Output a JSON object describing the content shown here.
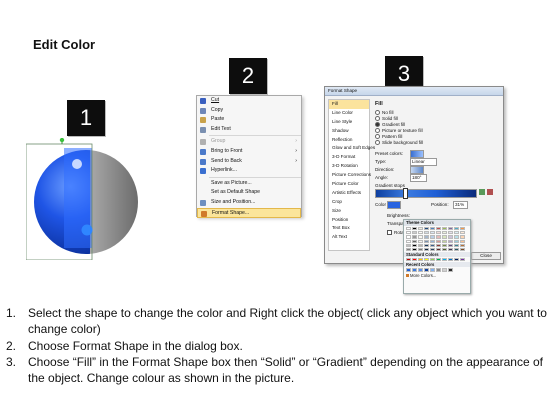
{
  "title": "Edit Color",
  "step_badges": [
    "1",
    "2",
    "3"
  ],
  "context_menu": {
    "items": [
      {
        "label": "Cut",
        "icon": "scissors-icon",
        "color": "#3a5fbf"
      },
      {
        "label": "Copy",
        "icon": "copy-icon",
        "color": "#6d86b8"
      },
      {
        "label": "Paste",
        "icon": "paste-icon",
        "color": "#c9a24a"
      },
      {
        "label": "Edit Text",
        "icon": "edit-text-icon",
        "color": "#7a8fb0"
      },
      {
        "label": "Group",
        "icon": "group-icon",
        "color": "#b0b0b0",
        "disabled": true,
        "submenu": true
      },
      {
        "label": "Bring to Front",
        "icon": "bring-front-icon",
        "color": "#4b79c9",
        "submenu": true
      },
      {
        "label": "Send to Back",
        "icon": "send-back-icon",
        "color": "#4b79c9",
        "submenu": true
      },
      {
        "label": "Hyperlink...",
        "icon": "hyperlink-icon",
        "color": "#3a6fd0"
      },
      {
        "label": "Save as Picture...",
        "icon": "",
        "color": ""
      },
      {
        "label": "Set as Default Shape",
        "icon": "",
        "color": ""
      },
      {
        "label": "Size and Position...",
        "icon": "size-position-icon",
        "color": "#6e8fc0"
      },
      {
        "label": "Format Shape...",
        "icon": "format-shape-icon",
        "color": "#d07a2a",
        "highlighted": true
      }
    ]
  },
  "format_dialog": {
    "window_title": "Format Shape",
    "sidebar": [
      "Fill",
      "Line Color",
      "Line Style",
      "Shadow",
      "Reflection",
      "Glow and Soft Edges",
      "3-D Format",
      "3-D Rotation",
      "Picture Corrections",
      "Picture Color",
      "Artistic Effects",
      "Crop",
      "Size",
      "Position",
      "Text Box",
      "Alt Text"
    ],
    "section_title": "Fill",
    "fill_options": [
      {
        "label": "No fill",
        "selected": false
      },
      {
        "label": "Solid fill",
        "selected": false
      },
      {
        "label": "Gradient fill",
        "selected": true
      },
      {
        "label": "Picture or texture fill",
        "selected": false
      },
      {
        "label": "Pattern fill",
        "selected": false
      },
      {
        "label": "Slide background fill",
        "selected": false
      }
    ],
    "preset_colors_label": "Preset colors:",
    "type_label": "Type:",
    "type_value": "Linear",
    "direction_label": "Direction:",
    "angle_label": "Angle:",
    "angle_value": "180°",
    "gradient_stops_label": "Gradient stops",
    "color_label": "Color",
    "position_label": "Position:",
    "position_value": "31%",
    "brightness_label": "Brightness:",
    "transparency_label": "Transparency:",
    "rotate_label": "Rotate w",
    "close_label": "Close"
  },
  "palette": {
    "theme_header": "Theme Colors",
    "standard_label": "Standard Colors",
    "recent_label": "Recent Colors",
    "more_colors_label": "More Colors...",
    "theme_row": [
      "#ffffff",
      "#000000",
      "#eeece1",
      "#1f497d",
      "#4f81bd",
      "#c0504d",
      "#9bbb59",
      "#8064a2",
      "#4bacc6",
      "#f79646"
    ],
    "standard_row": [
      "#c00000",
      "#ff0000",
      "#ffc000",
      "#ffff00",
      "#92d050",
      "#00b050",
      "#00b0f0",
      "#0070c0",
      "#002060",
      "#7030a0"
    ],
    "recent_row": [
      "#1f5fd6",
      "#3c7be0",
      "#5a90e8",
      "#0d3fa0",
      "#7fb0f0",
      "#8a8a8a",
      "#cfcfcf",
      "#2c2c2c"
    ]
  },
  "colors": {
    "sphere_blue": "#1a4fe0",
    "sphere_gray": "#9a9a9a",
    "badge_bg": "#0d0d0d",
    "highlight": "#fbe59b"
  },
  "instructions": [
    {
      "num": "1.",
      "text": "Select the shape to change the color and Right click the object( click any object which you want to change color)"
    },
    {
      "num": "2.",
      "text": "Choose Format Shape in the dialog box."
    },
    {
      "num": "3.",
      "text": "Choose “Fill” in the Format Shape box then “Solid” or “Gradient” depending on the appearance of the object. Change colour as shown in the picture."
    }
  ]
}
